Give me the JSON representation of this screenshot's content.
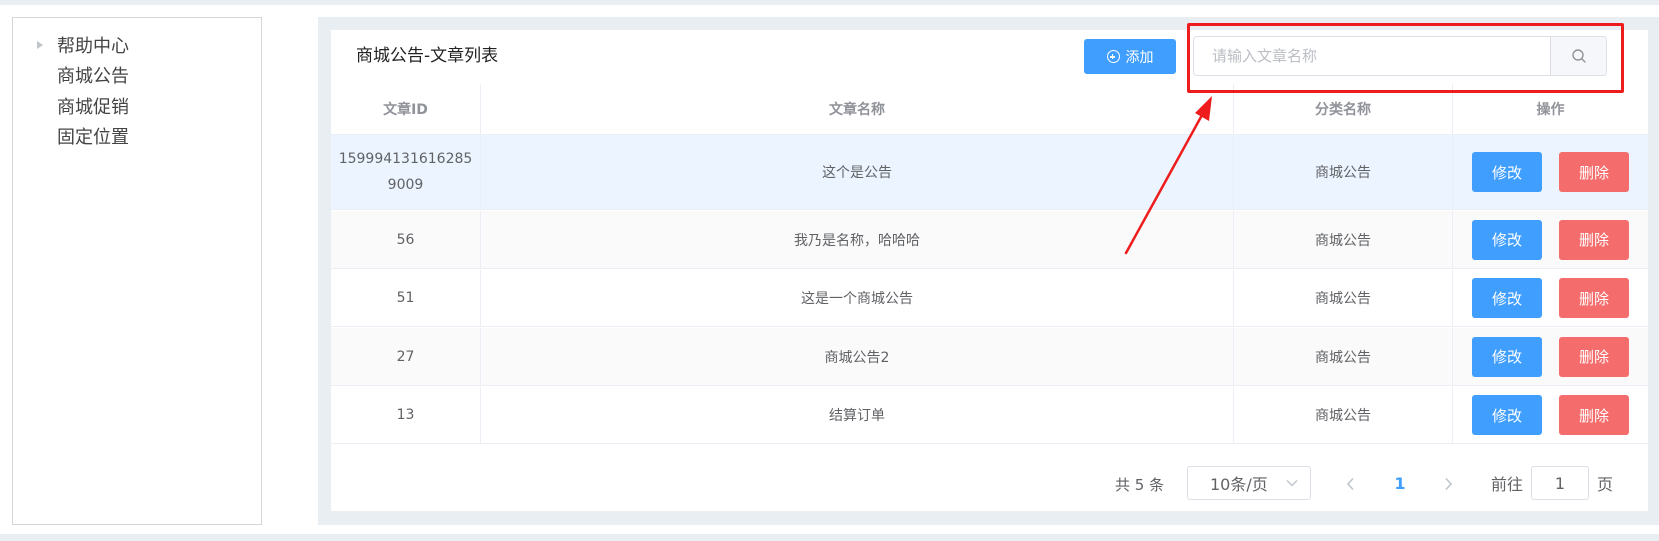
{
  "sidebar": {
    "items": [
      {
        "label": "帮助中心",
        "expandable": true
      },
      {
        "label": "商城公告"
      },
      {
        "label": "商城促销"
      },
      {
        "label": "固定位置"
      }
    ]
  },
  "header": {
    "title": "商城公告-文章列表",
    "add_label": "添加",
    "search_placeholder": "请输入文章名称",
    "search_value": ""
  },
  "table": {
    "columns": [
      "文章ID",
      "文章名称",
      "分类名称",
      "操作"
    ],
    "rows": [
      {
        "id": "1599941316162859009",
        "name": "这个是公告",
        "category": "商城公告",
        "edit": "修改",
        "delete": "删除"
      },
      {
        "id": "56",
        "name": "我乃是名称，哈哈哈",
        "category": "商城公告",
        "edit": "修改",
        "delete": "删除"
      },
      {
        "id": "51",
        "name": "这是一个商城公告",
        "category": "商城公告",
        "edit": "修改",
        "delete": "删除"
      },
      {
        "id": "27",
        "name": "商城公告2",
        "category": "商城公告",
        "edit": "修改",
        "delete": "删除"
      },
      {
        "id": "13",
        "name": "结算订单",
        "category": "商城公告",
        "edit": "修改",
        "delete": "删除"
      }
    ]
  },
  "pagination": {
    "total": "共 5 条",
    "page_size": "10条/页",
    "current_page": "1",
    "goto_label": "前往",
    "goto_value": "1",
    "goto_suffix": "页"
  },
  "colors": {
    "primary": "#409eff",
    "danger": "#f56c6c",
    "annotation": "#ee1c1c",
    "hover_row": "#ecf5ff",
    "stripe_row": "#fafafa"
  }
}
